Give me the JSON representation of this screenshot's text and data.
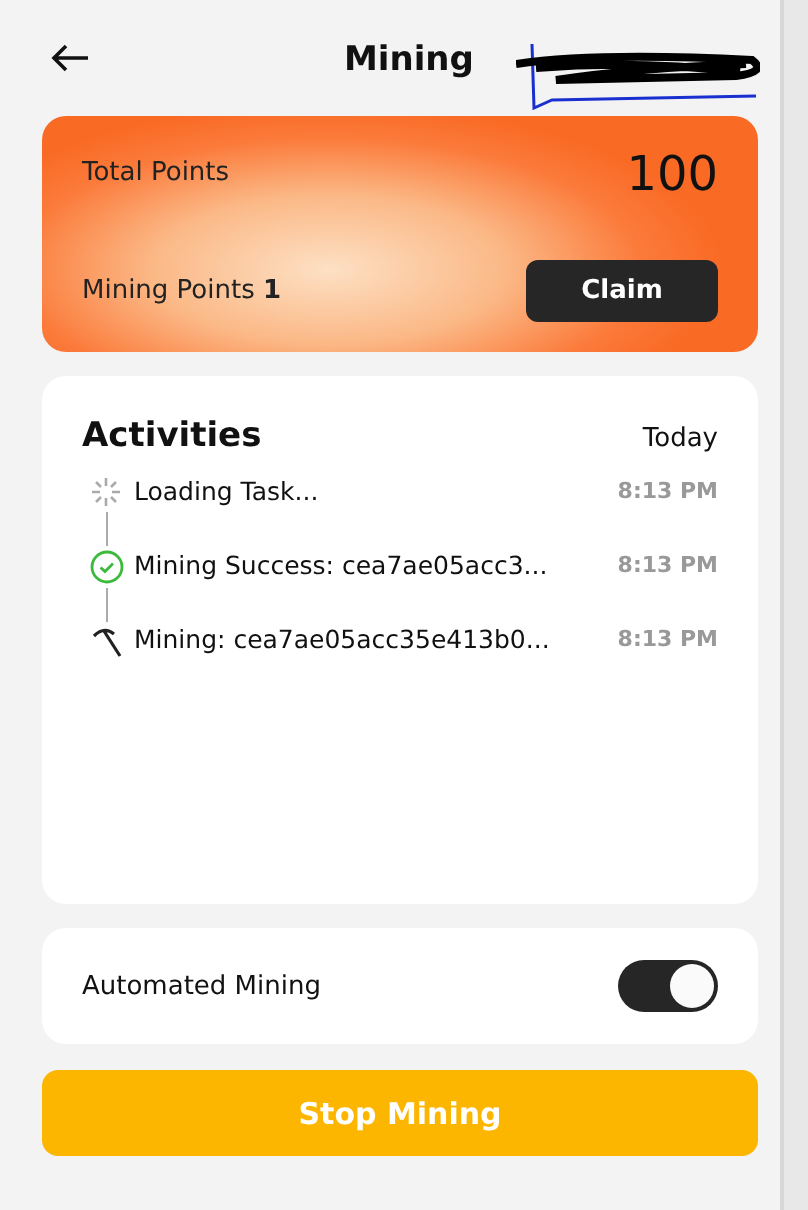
{
  "header": {
    "title": "Mining"
  },
  "points_card": {
    "total_label": "Total Points",
    "total_value": "100",
    "mining_label": "Mining Points **1**",
    "claim_button": "Claim"
  },
  "activities": {
    "title": "Activities",
    "date": "Today",
    "items": [
      {
        "kind": "loading",
        "text": "Loading Task...",
        "time": "8:13 PM"
      },
      {
        "kind": "success",
        "text": "Mining Success: cea7ae05acc3...",
        "time": "8:13 PM"
      },
      {
        "kind": "mining",
        "text": "Mining: cea7ae05acc35e413b0...",
        "time": "8:13 PM"
      }
    ]
  },
  "automation": {
    "label": "Automated Mining",
    "on": true
  },
  "stop_button": "Stop Mining"
}
